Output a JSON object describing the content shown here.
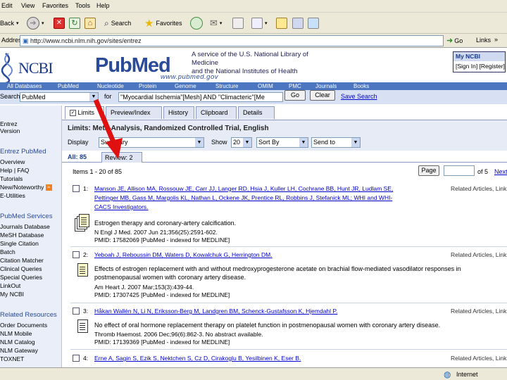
{
  "browser": {
    "menu": [
      "Edit",
      "View",
      "Favorites",
      "Tools",
      "Help"
    ],
    "toolbar": {
      "back_label": "Back",
      "search_label": "Search",
      "favorites_label": "Favorites"
    },
    "address": {
      "label": "Address",
      "url": "http://www.ncbi.nlm.nih.gov/sites/entrez",
      "go_label": "Go",
      "links_label": "Links"
    },
    "status": {
      "zone": "Internet"
    }
  },
  "header": {
    "ncbi_logo": "NCBI",
    "pubmed_logo": "PubMed",
    "pubmed_url": "www.pubmed.gov",
    "tagline_1": "A service of the U.S. National Library of Medicine",
    "tagline_2": "and the National Institutes of Health",
    "myncbi": "My NCBI",
    "signin": "[Sign In] [Register]"
  },
  "nav": [
    "All Databases",
    "PubMed",
    "Nucleotide",
    "Protein",
    "Genome",
    "Structure",
    "OMIM",
    "PMC",
    "Journals",
    "Books"
  ],
  "search": {
    "search_label": "Search",
    "db_value": "PubMed",
    "for_label": "for",
    "query": "\"Myocardial Ischemia\"[Mesh] AND \"Climacteric\"[Me",
    "go_label": "Go",
    "clear_label": "Clear",
    "save_label": "Save Search"
  },
  "tabs": [
    "Limits",
    "Preview/Index",
    "History",
    "Clipboard",
    "Details"
  ],
  "limits_text": "Limits: Meta-Analysis, Randomized Controlled Trial, English",
  "display": {
    "display_label": "Display",
    "display_value": "Summary",
    "show_label": "Show",
    "show_value": "20",
    "sort_value": "Sort By",
    "send_value": "Send to"
  },
  "subtabs": {
    "all": "All: 85",
    "review": "Review: 2"
  },
  "pager": {
    "items": "Items 1 - 20 of 85",
    "page_label": "Page",
    "of": "of 5",
    "next": "Next"
  },
  "sidebar": {
    "items_top": [
      "Entrez",
      "Version"
    ],
    "entrez_heading": "Entrez PubMed",
    "entrez_items": [
      "Overview",
      "Help | FAQ",
      "Tutorials",
      "New/Noteworthy",
      "E-Utilities"
    ],
    "services_heading": "PubMed Services",
    "services_items": [
      "Journals Database",
      "MeSH Database",
      "Single Citation",
      "Batch",
      "Citation Matcher",
      "Clinical Queries",
      "Special Queries",
      "LinkOut",
      "My NCBI"
    ],
    "related_heading": "Related Resources",
    "related_items": [
      "Order Documents",
      "NLM Mobile",
      "NLM Catalog",
      "NLM Gateway",
      "TOXNET"
    ]
  },
  "results": [
    {
      "num": "1:",
      "authors_1": "Manson JE, Allison MA, Rossouw JE, Carr JJ, Langer RD, Hsia J, Kuller LH, Cochrane BB, Hunt JR, Ludlam SE,",
      "authors_2": "Pettinger MB, Gass M, Margolis KL, Nathan L, Ockene JK, Prentice RL, Robbins J, Stefanick ML; WHI and WHI-",
      "authors_3": "CACS Investigators.",
      "title": "Estrogen therapy and coronary-artery calcification.",
      "journal": "N Engl J Med. 2007 Jun 21;356(25):2591-602.",
      "pmid": "PMID: 17582069 [PubMed - indexed for MEDLINE]",
      "related": "Related Articles, Links"
    },
    {
      "num": "2:",
      "authors_1": "Yeboah J, Reboussin DM, Waters D, Kowalchuk G, Herrington DM.",
      "title_1": "Effects of estrogen replacement with and without medroxyprogesterone acetate on brachial flow-mediated vasodilator responses in",
      "title_2": "postmenopausal women with coronary artery disease.",
      "journal": "Am Heart J. 2007 Mar;153(3):439-44.",
      "pmid": "PMID: 17307425 [PubMed - indexed for MEDLINE]",
      "related": "Related Articles, Links"
    },
    {
      "num": "3:",
      "authors_1": "Håkan Wallén N, Li N, Eriksson-Berg M, Landgren BM, Schenck-Gustafsson K, Hjemdahl P.",
      "title_1": "No effect of oral hormone replacement therapy on platelet function in postmenopausal women with coronary artery disease.",
      "journal": "Thromb Haemost. 2006 Dec;96(6):862-3. No abstract available.",
      "pmid": "PMID: 17139369 [PubMed - indexed for MEDLINE]",
      "related": "Related Articles, Links"
    },
    {
      "num": "4:",
      "authors_1": "Erne A, Sagin S, Ezik S, Nektchen S, Cz D, Cirakoglu B, Yesilbinen K, Eser B.",
      "related": "Related Articles, Links"
    }
  ]
}
